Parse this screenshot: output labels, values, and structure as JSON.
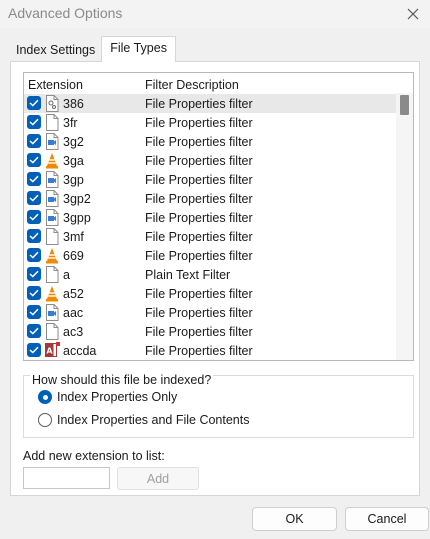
{
  "window": {
    "title": "Advanced Options"
  },
  "tabs": [
    {
      "label": "Index Settings",
      "active": false
    },
    {
      "label": "File Types",
      "active": true
    }
  ],
  "list": {
    "headers": {
      "extension": "Extension",
      "description": "Filter Description"
    },
    "rows": [
      {
        "ext": "386",
        "desc": "File Properties filter",
        "checked": true,
        "icon": "gear-file-icon",
        "selected": true
      },
      {
        "ext": "3fr",
        "desc": "File Properties filter",
        "checked": true,
        "icon": "blank-file-icon",
        "selected": false
      },
      {
        "ext": "3g2",
        "desc": "File Properties filter",
        "checked": true,
        "icon": "media-file-icon",
        "selected": false
      },
      {
        "ext": "3ga",
        "desc": "File Properties filter",
        "checked": true,
        "icon": "vlc-cone-icon",
        "selected": false
      },
      {
        "ext": "3gp",
        "desc": "File Properties filter",
        "checked": true,
        "icon": "media-file-icon",
        "selected": false
      },
      {
        "ext": "3gp2",
        "desc": "File Properties filter",
        "checked": true,
        "icon": "media-file-icon",
        "selected": false
      },
      {
        "ext": "3gpp",
        "desc": "File Properties filter",
        "checked": true,
        "icon": "media-file-icon",
        "selected": false
      },
      {
        "ext": "3mf",
        "desc": "File Properties filter",
        "checked": true,
        "icon": "blank-file-icon",
        "selected": false
      },
      {
        "ext": "669",
        "desc": "File Properties filter",
        "checked": true,
        "icon": "vlc-cone-icon",
        "selected": false
      },
      {
        "ext": "a",
        "desc": "Plain Text Filter",
        "checked": true,
        "icon": "blank-file-icon",
        "selected": false
      },
      {
        "ext": "a52",
        "desc": "File Properties filter",
        "checked": true,
        "icon": "vlc-cone-icon",
        "selected": false
      },
      {
        "ext": "aac",
        "desc": "File Properties filter",
        "checked": true,
        "icon": "media-file-icon",
        "selected": false
      },
      {
        "ext": "ac3",
        "desc": "File Properties filter",
        "checked": true,
        "icon": "blank-file-icon",
        "selected": false
      },
      {
        "ext": "accda",
        "desc": "File Properties filter",
        "checked": true,
        "icon": "access-icon",
        "selected": false
      }
    ]
  },
  "index_group": {
    "label": "How should this file be indexed?",
    "options": [
      {
        "label": "Index Properties Only",
        "selected": true
      },
      {
        "label": "Index Properties and File Contents",
        "selected": false
      }
    ]
  },
  "add_extension": {
    "label": "Add new extension to list:",
    "value": "",
    "button": "Add"
  },
  "footer": {
    "ok": "OK",
    "cancel": "Cancel"
  },
  "colors": {
    "accent": "#005fb8",
    "selected_row": "#e8e8e8",
    "vlc_orange": "#f08a00",
    "access_red": "#a4373a"
  }
}
